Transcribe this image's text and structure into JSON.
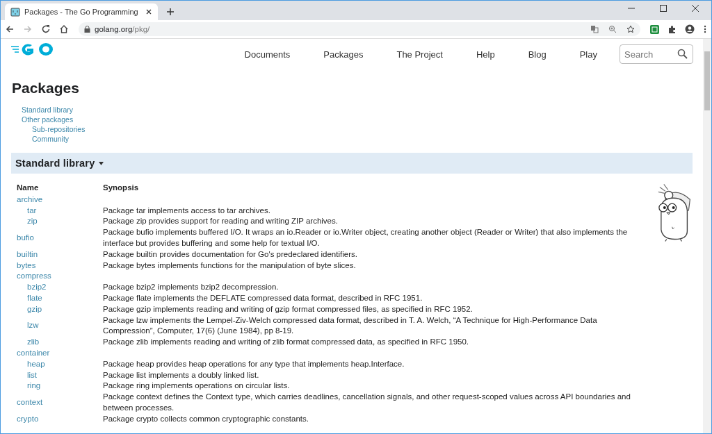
{
  "browser": {
    "tab_title": "Packages - The Go Programming",
    "url_host": "golang.org",
    "url_path": "/pkg/"
  },
  "nav": {
    "items": [
      "Documents",
      "Packages",
      "The Project",
      "Help",
      "Blog",
      "Play"
    ],
    "search": {
      "placeholder": "Search"
    }
  },
  "page": {
    "title": "Packages",
    "toc": [
      {
        "label": "Standard library"
      },
      {
        "label": "Other packages",
        "children": [
          {
            "label": "Sub-repositories"
          },
          {
            "label": "Community"
          }
        ]
      }
    ]
  },
  "section": {
    "title": "Standard library",
    "expanded": true
  },
  "table": {
    "columns": [
      "Name",
      "Synopsis"
    ],
    "rows": [
      {
        "name": "archive",
        "synopsis": "",
        "children": [
          {
            "name": "tar",
            "synopsis": "Package tar implements access to tar archives."
          },
          {
            "name": "zip",
            "synopsis": "Package zip provides support for reading and writing ZIP archives."
          }
        ]
      },
      {
        "name": "bufio",
        "synopsis": "Package bufio implements buffered I/O. It wraps an io.Reader or io.Writer object, creating another object (Reader or Writer) that also implements the interface but provides buffering and some help for textual I/O.",
        "children": []
      },
      {
        "name": "builtin",
        "synopsis": "Package builtin provides documentation for Go's predeclared identifiers.",
        "children": []
      },
      {
        "name": "bytes",
        "synopsis": "Package bytes implements functions for the manipulation of byte slices.",
        "children": []
      },
      {
        "name": "compress",
        "synopsis": "",
        "children": [
          {
            "name": "bzip2",
            "synopsis": "Package bzip2 implements bzip2 decompression."
          },
          {
            "name": "flate",
            "synopsis": "Package flate implements the DEFLATE compressed data format, described in RFC 1951."
          },
          {
            "name": "gzip",
            "synopsis": "Package gzip implements reading and writing of gzip format compressed files, as specified in RFC 1952."
          },
          {
            "name": "lzw",
            "synopsis": "Package lzw implements the Lempel-Ziv-Welch compressed data format, described in T. A. Welch, “A Technique for High-Performance Data Compression”, Computer, 17(6) (June 1984), pp 8-19."
          },
          {
            "name": "zlib",
            "synopsis": "Package zlib implements reading and writing of zlib format compressed data, as specified in RFC 1950."
          }
        ]
      },
      {
        "name": "container",
        "synopsis": "",
        "children": [
          {
            "name": "heap",
            "synopsis": "Package heap provides heap operations for any type that implements heap.Interface."
          },
          {
            "name": "list",
            "synopsis": "Package list implements a doubly linked list."
          },
          {
            "name": "ring",
            "synopsis": "Package ring implements operations on circular lists."
          }
        ]
      },
      {
        "name": "context",
        "synopsis": "Package context defines the Context type, which carries deadlines, cancellation signals, and other request-scoped values across API boundaries and between processes.",
        "children": []
      },
      {
        "name": "crypto",
        "synopsis": "Package crypto collects common cryptographic constants.",
        "children": []
      }
    ]
  }
}
